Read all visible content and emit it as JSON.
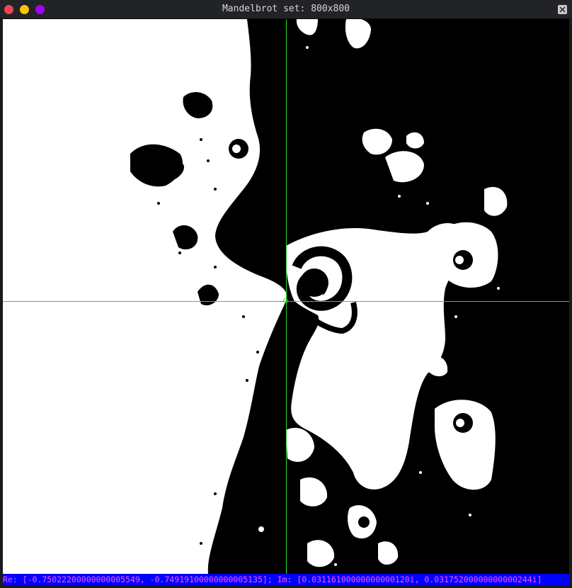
{
  "window": {
    "title": "Mandelbrot set: 800x800"
  },
  "status": {
    "text": "Re: [-0.75022200000000005549, -0.74919100000000005135]; Im: [0.03116100000000000120i, 0.03175200000000000244i]"
  },
  "colors": {
    "set": "#000000",
    "escape": "#ffffff",
    "crosshair": "#22dd22",
    "status_bg": "#0000ff",
    "status_fg": "#ff58ff"
  },
  "icons": {
    "close": "close-dot-icon",
    "minimize": "minimize-dot-icon",
    "maximize": "maximize-dot-icon",
    "window_close": "close-x-icon"
  }
}
